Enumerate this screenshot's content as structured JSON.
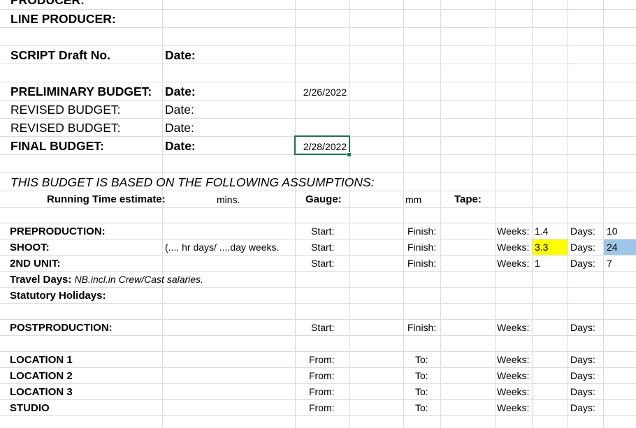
{
  "rows": {
    "producer": "PRODUCER:",
    "line_producer": "LINE PRODUCER:",
    "script_draft": "SCRIPT Draft No.",
    "preliminary_budget": "PRELIMINARY BUDGET:",
    "revised_budget_1": "REVISED BUDGET:",
    "revised_budget_2": "REVISED BUDGET:",
    "final_budget": "FINAL BUDGET:",
    "assumptions": "THIS BUDGET IS BASED ON THE FOLLOWING ASSUMPTIONS:",
    "running_time": "Running Time estimate:",
    "mins": "mins.",
    "gauge": "Gauge:",
    "mm": "mm",
    "tape": "Tape:",
    "preproduction": "PREPRODUCTION:",
    "shoot": "SHOOT:",
    "shoot_note": "(.... hr days/ ....day weeks.",
    "second_unit": "2ND UNIT:",
    "travel_days": "Travel Days:",
    "travel_note": "NB.incl.in Crew/Cast salaries.",
    "statutory_holidays": "Statutory Holidays:",
    "postproduction": "POSTPRODUCTION:",
    "location_1": "LOCATION 1",
    "location_2": "LOCATION 2",
    "location_3": "LOCATION 3",
    "studio": "STUDIO"
  },
  "labels": {
    "date": "Date:",
    "start": "Start:",
    "finish": "Finish:",
    "weeks": "Weeks:",
    "days": "Days:",
    "from": "From:",
    "to": "To:"
  },
  "values": {
    "preliminary_date": "2/26/2022",
    "final_date": "2/28/2022",
    "preproduction_weeks": "1.4",
    "preproduction_days": "10",
    "shoot_weeks": "3.3",
    "shoot_days": "24",
    "second_unit_weeks": "1",
    "second_unit_days": "7"
  },
  "colors": {
    "highlight_yellow": "#ffff00",
    "highlight_blue": "#9fc5e8",
    "selection": "#217346"
  }
}
